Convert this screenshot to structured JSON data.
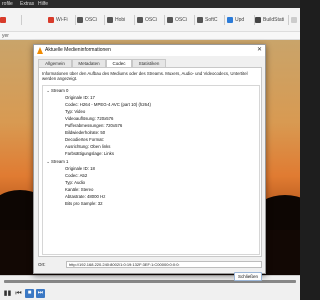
{
  "menubar": {
    "items": [
      "rofile",
      "Extras",
      "Hilfe"
    ]
  },
  "browser_tabs": [
    {
      "label": "",
      "color": "#d83b2b"
    },
    {
      "label": "Wi-Fi",
      "color": "#d83b2b"
    },
    {
      "label": "OSCi",
      "color": "#555555"
    },
    {
      "label": "Hobi",
      "color": "#555555"
    },
    {
      "label": "OSCi",
      "color": "#555555"
    },
    {
      "label": "OSCi",
      "color": "#555555"
    },
    {
      "label": "SoftC",
      "color": "#555555"
    },
    {
      "label": "Upd",
      "color": "#2b7bd8"
    },
    {
      "label": "BuildStati",
      "color": "#444444"
    },
    {
      "label": "",
      "color": "#cccccc"
    }
  ],
  "player": {
    "title_fragment": "yer"
  },
  "dialog": {
    "title": "Aktuelle Medieninformationen",
    "close_glyph": "✕",
    "tabs": [
      "Allgemein",
      "Metadaten",
      "Codec",
      "Statistiken"
    ],
    "active_tab": "Codec",
    "description": "Informationen über den Aufbau des Mediums oder des Streams. Muxers, Audio- und Videocodecs, Untertitel werden angezeigt.",
    "streams": [
      {
        "label": "Stream 0",
        "items": [
          "Originale ID: 17",
          "Codec: H264 - MPEG-4 AVC (part 10) (h264)",
          "Typ: Video",
          "Videoauflösung: 720x576",
          "Pufferabmessungen: 720x576",
          "Bildwiederholrate: 50",
          "Decodiertes Format:",
          "Ausrichtung: Oben links",
          "Farbsättigungslage: Links"
        ]
      },
      {
        "label": "Stream 1",
        "items": [
          "Originale ID: 18",
          "Codec: A52",
          "Typ: Audio",
          "Kanäle: Stereo",
          "Abtastrate: 48000 Hz",
          "Bits pro Sample: 32"
        ]
      }
    ],
    "location_label": "Ort:",
    "location_value": "http://192.168.220.240:8002/1:0:19:132F:3EF:1:C00000:0:0:0:",
    "close_button": "Schließen"
  },
  "controls": {
    "seek_progress": 1.0
  }
}
